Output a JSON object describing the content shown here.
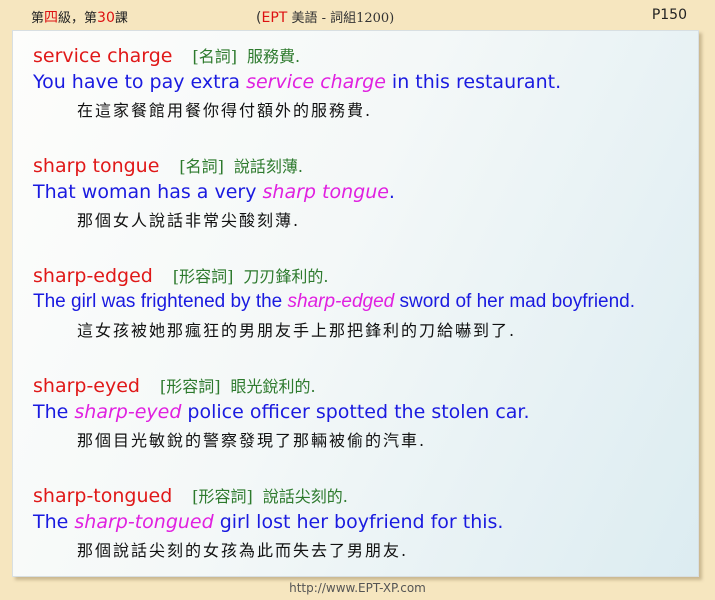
{
  "header": {
    "lesson_pre": "第",
    "lesson_level": "四",
    "lesson_mid": "級，第",
    "lesson_num": "30",
    "lesson_post": "課",
    "title_open": "(",
    "title_ept": "EPT",
    "title_rest": " 美語 - 詞組1200)",
    "page": "P150"
  },
  "entries": [
    {
      "term": "service charge",
      "pos": "[名詞]",
      "meaning": "服務費.",
      "sentence_pre": "You have to pay extra ",
      "sentence_kw": "service charge",
      "sentence_post": " in this restaurant.",
      "translation": "在這家餐館用餐你得付額外的服務費."
    },
    {
      "term": "sharp tongue",
      "pos": "[名詞]",
      "meaning": "說話刻薄.",
      "sentence_pre": "That woman has a very ",
      "sentence_kw": "sharp tongue",
      "sentence_post": ".",
      "translation": "那個女人說話非常尖酸刻薄."
    },
    {
      "term": "sharp-edged",
      "pos": "[形容詞]",
      "meaning": "刀刃鋒利的.",
      "sentence_pre": "The girl was frightened by the ",
      "sentence_kw": "sharp-edged",
      "sentence_post": " sword of her mad boyfriend.",
      "translation": "這女孩被她那瘋狂的男朋友手上那把鋒利的刀給嚇到了."
    },
    {
      "term": "sharp-eyed",
      "pos": "[形容詞]",
      "meaning": "眼光銳利的.",
      "sentence_pre": "The ",
      "sentence_kw": "sharp-eyed",
      "sentence_post": " police officer spotted the stolen car.",
      "translation": "那個目光敏銳的警察發現了那輛被偷的汽車."
    },
    {
      "term": "sharp-tongued",
      "pos": "[形容詞]",
      "meaning": "說話尖刻的.",
      "sentence_pre": "The ",
      "sentence_kw": "sharp-tongued",
      "sentence_post": " girl lost her boyfriend for this.",
      "translation": "那個說話尖刻的女孩為此而失去了男朋友."
    }
  ],
  "footer": {
    "url": "http://www.EPT-XP.com"
  },
  "colors": {
    "term": "#e01818",
    "pos": "#2d7a2d",
    "sentence": "#1a1ae0",
    "keyword": "#e020e0",
    "background": "#f6e6bf"
  }
}
